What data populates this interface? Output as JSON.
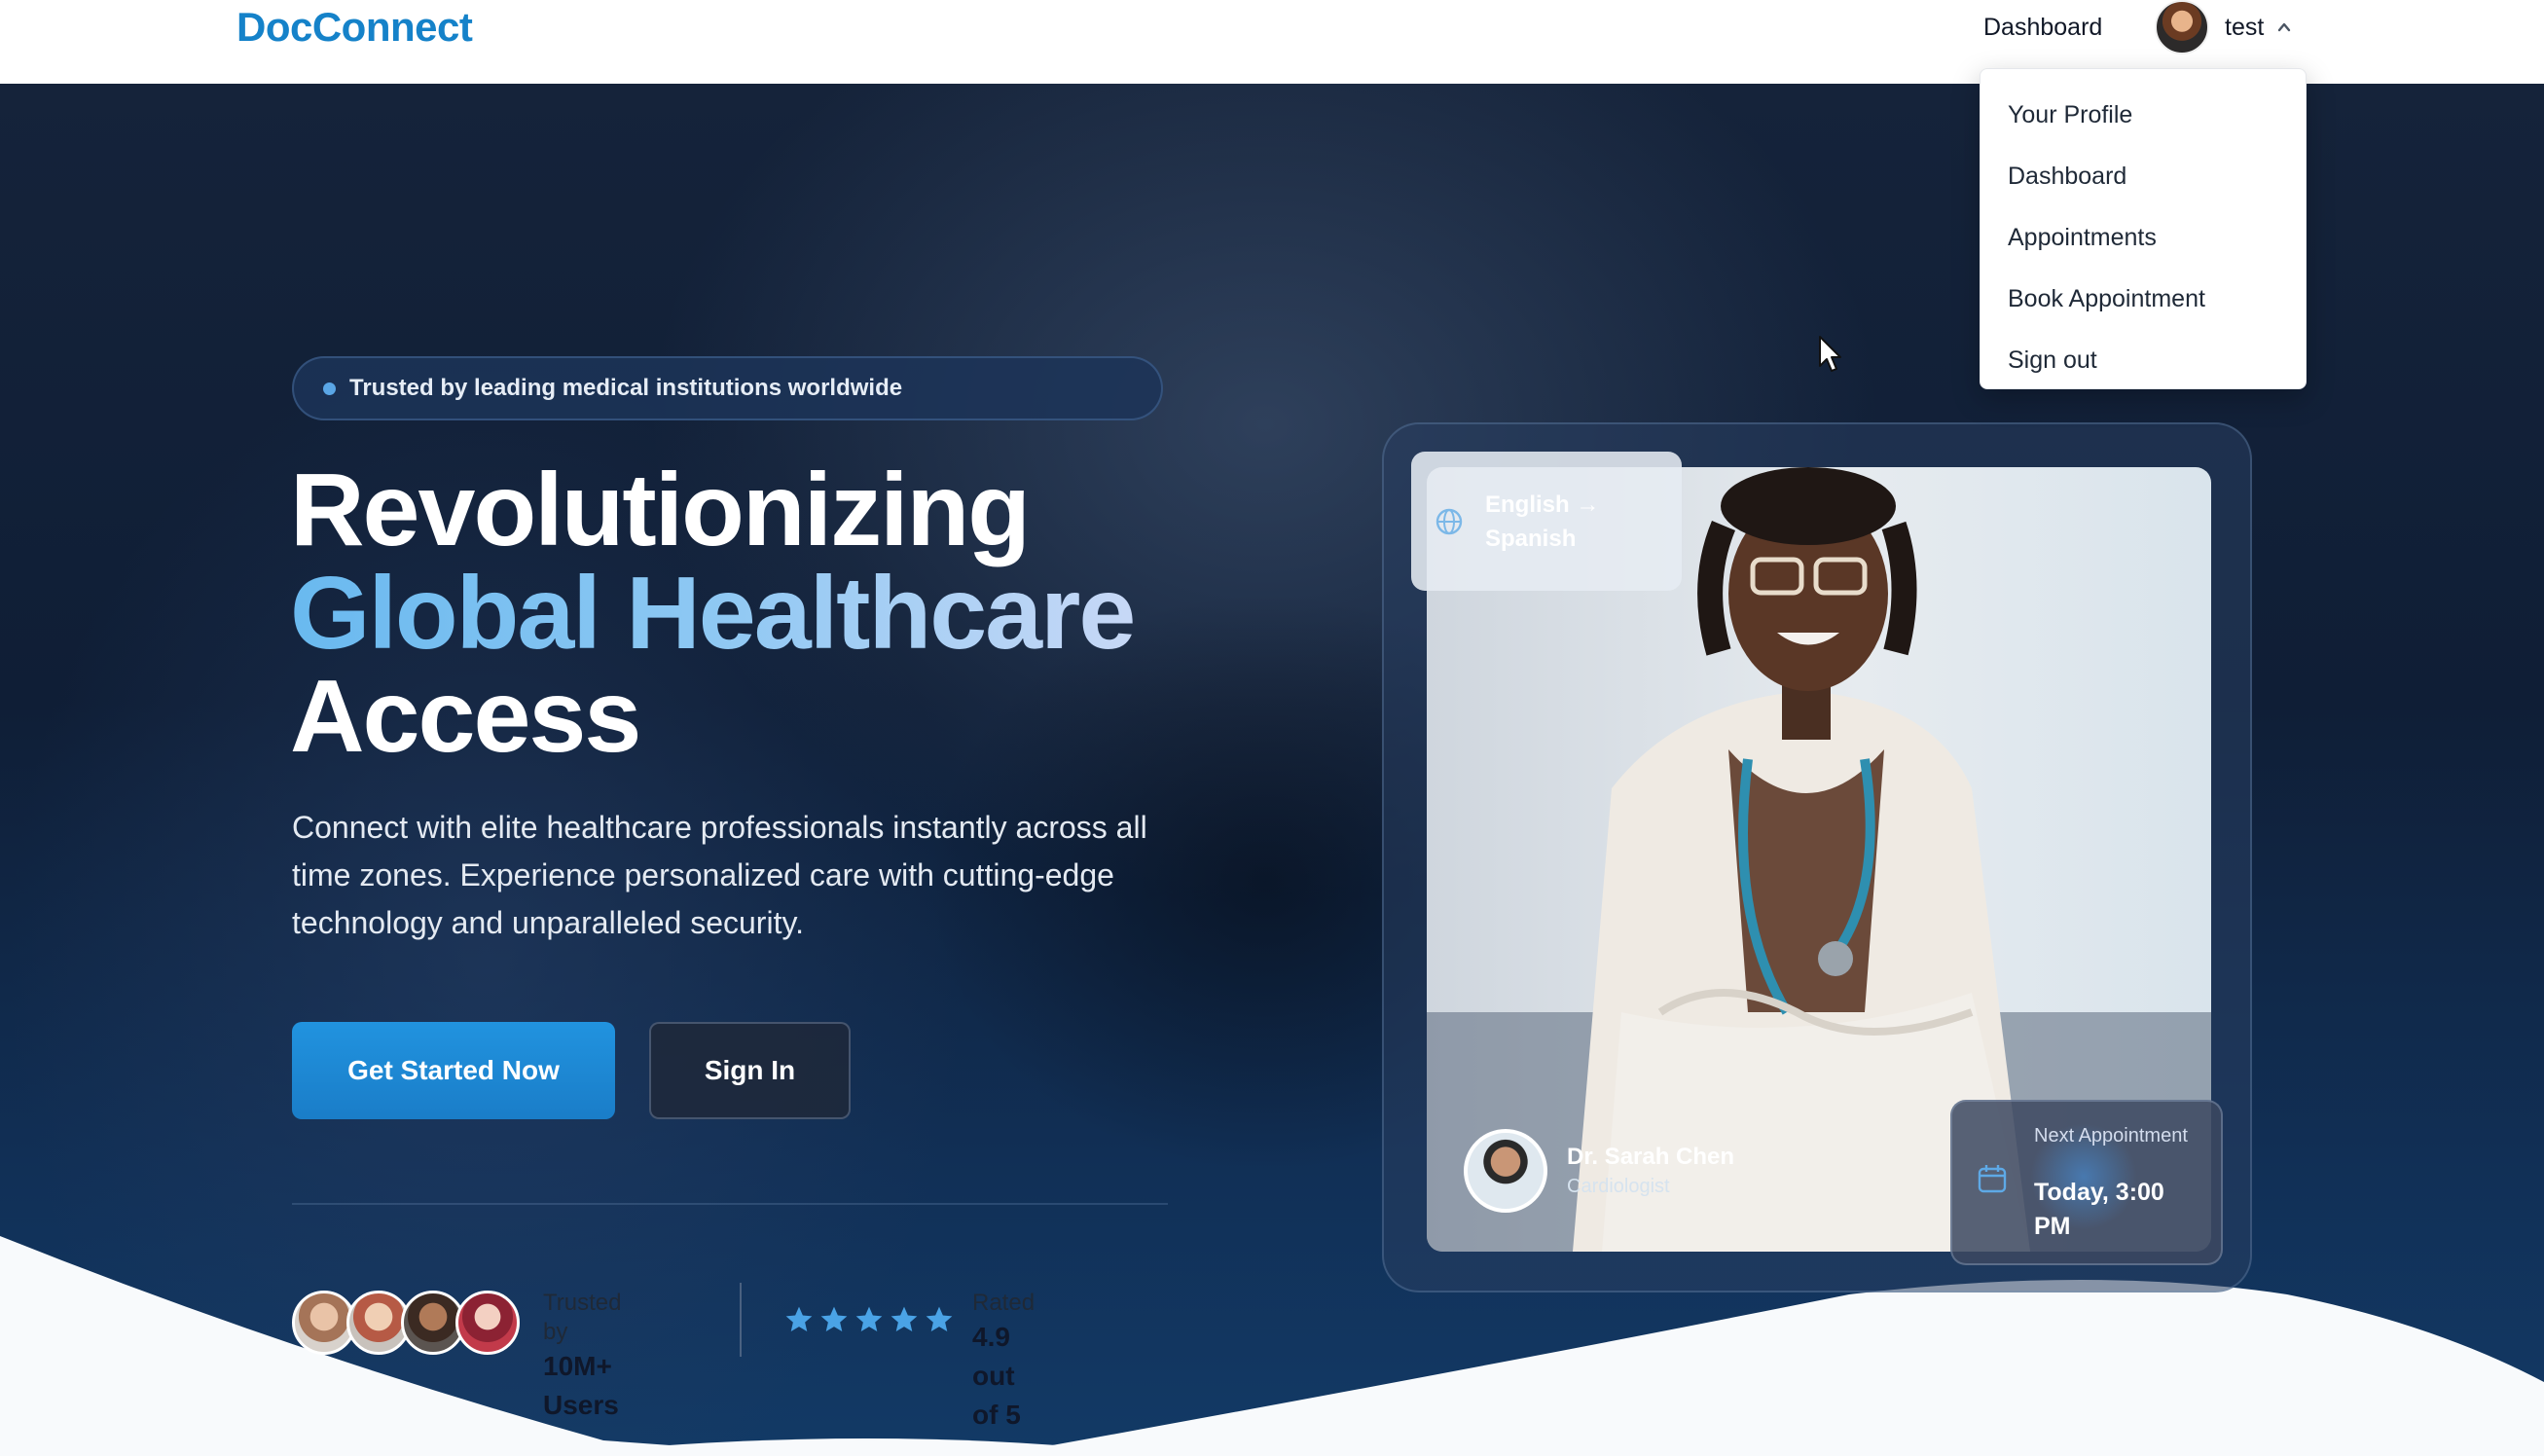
{
  "header": {
    "logo": "DocConnect",
    "nav_dashboard": "Dashboard",
    "user_name": "test"
  },
  "user_dropdown": {
    "items": [
      {
        "label": "Your Profile"
      },
      {
        "label": "Dashboard"
      },
      {
        "label": "Appointments"
      },
      {
        "label": "Book Appointment"
      },
      {
        "label": "Sign out"
      }
    ]
  },
  "hero": {
    "badge": "Trusted by leading medical institutions worldwide",
    "headline_line1": "Revolutionizing",
    "headline_line2": "Global Healthcare",
    "headline_line3": "Access",
    "description": "Connect with elite healthcare professionals instantly across all time zones. Experience personalized care with cutting-edge technology and unparalleled security.",
    "primary_cta": "Get Started Now",
    "secondary_cta": "Sign In"
  },
  "social_proof": {
    "users_label": "Trusted by",
    "users_value": "10M+ Users",
    "rating_label": "Rated",
    "rating_value": "4.9 out of 5",
    "stars": 5
  },
  "doctor_card": {
    "translation": "English → Spanish",
    "doctor_name": "Dr. Sarah Chen",
    "doctor_specialty": "Cardiologist",
    "next_appointment_label": "Next Appointment",
    "next_appointment_time": "Today, 3:00 PM"
  },
  "colors": {
    "brand": "#1582c9",
    "primary_button": "#1a86d6",
    "star": "#4aa3e6",
    "hero_dark": "#0f1e36"
  },
  "icons": [
    "chevron-up-icon",
    "globe-icon",
    "calendar-icon",
    "star-icon",
    "cursor-icon"
  ]
}
